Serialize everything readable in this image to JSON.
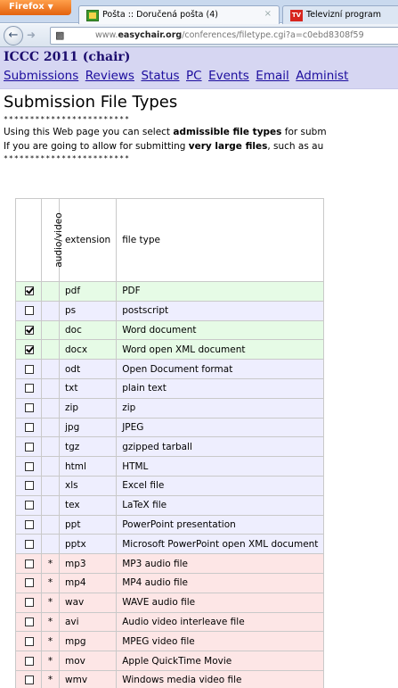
{
  "browser": {
    "firefox_label": "Firefox",
    "tabs": [
      {
        "label": "Pošta :: Doručená pošta (4)",
        "icon": "mail-icon",
        "active": true
      },
      {
        "label": "Televizní program",
        "icon": "tv-icon",
        "active": false
      }
    ],
    "url_prefix": "www.",
    "url_domain": "easychair.org",
    "url_path": "/conferences/filetype.cgi?a=c0ebd8308f59"
  },
  "site": {
    "conference": "ICCC 2011 (chair)",
    "menu": [
      "Submissions",
      "Reviews",
      "Status",
      "PC",
      "Events",
      "Email",
      "Administ"
    ]
  },
  "main": {
    "title": "Submission File Types",
    "stars": "************************",
    "intro1_pre": "Using this Web page you can select ",
    "intro1_bold": "admissible file types",
    "intro1_post": " for subm",
    "intro2_pre": "If you are going to allow for submitting ",
    "intro2_bold": "very large files",
    "intro2_post": ", such as au",
    "stars2": "************************"
  },
  "table": {
    "headers": {
      "av": "audio/video",
      "ext": "extension",
      "type": "file type"
    },
    "rows": [
      {
        "checked": true,
        "av": "",
        "ext": "pdf",
        "type": "PDF",
        "color": "green"
      },
      {
        "checked": false,
        "av": "",
        "ext": "ps",
        "type": "postscript",
        "color": "blue"
      },
      {
        "checked": true,
        "av": "",
        "ext": "doc",
        "type": "Word document",
        "color": "green"
      },
      {
        "checked": true,
        "av": "",
        "ext": "docx",
        "type": "Word open XML document",
        "color": "green"
      },
      {
        "checked": false,
        "av": "",
        "ext": "odt",
        "type": "Open Document format",
        "color": "blue"
      },
      {
        "checked": false,
        "av": "",
        "ext": "txt",
        "type": "plain text",
        "color": "blue"
      },
      {
        "checked": false,
        "av": "",
        "ext": "zip",
        "type": "zip",
        "color": "blue"
      },
      {
        "checked": false,
        "av": "",
        "ext": "jpg",
        "type": "JPEG",
        "color": "blue"
      },
      {
        "checked": false,
        "av": "",
        "ext": "tgz",
        "type": "gzipped tarball",
        "color": "blue"
      },
      {
        "checked": false,
        "av": "",
        "ext": "html",
        "type": "HTML",
        "color": "blue"
      },
      {
        "checked": false,
        "av": "",
        "ext": "xls",
        "type": "Excel file",
        "color": "blue"
      },
      {
        "checked": false,
        "av": "",
        "ext": "tex",
        "type": "LaTeX file",
        "color": "blue"
      },
      {
        "checked": false,
        "av": "",
        "ext": "ppt",
        "type": "PowerPoint presentation",
        "color": "blue"
      },
      {
        "checked": false,
        "av": "",
        "ext": "pptx",
        "type": "Microsoft PowerPoint open XML document",
        "color": "blue"
      },
      {
        "checked": false,
        "av": "*",
        "ext": "mp3",
        "type": "MP3 audio file",
        "color": "pink"
      },
      {
        "checked": false,
        "av": "*",
        "ext": "mp4",
        "type": "MP4 audio file",
        "color": "pink"
      },
      {
        "checked": false,
        "av": "*",
        "ext": "wav",
        "type": "WAVE audio file",
        "color": "pink"
      },
      {
        "checked": false,
        "av": "*",
        "ext": "avi",
        "type": "Audio video interleave file",
        "color": "pink"
      },
      {
        "checked": false,
        "av": "*",
        "ext": "mpg",
        "type": "MPEG video file",
        "color": "pink"
      },
      {
        "checked": false,
        "av": "*",
        "ext": "mov",
        "type": "Apple QuickTime Movie",
        "color": "pink"
      },
      {
        "checked": false,
        "av": "*",
        "ext": "wmv",
        "type": "Windows media video file",
        "color": "pink"
      }
    ]
  }
}
